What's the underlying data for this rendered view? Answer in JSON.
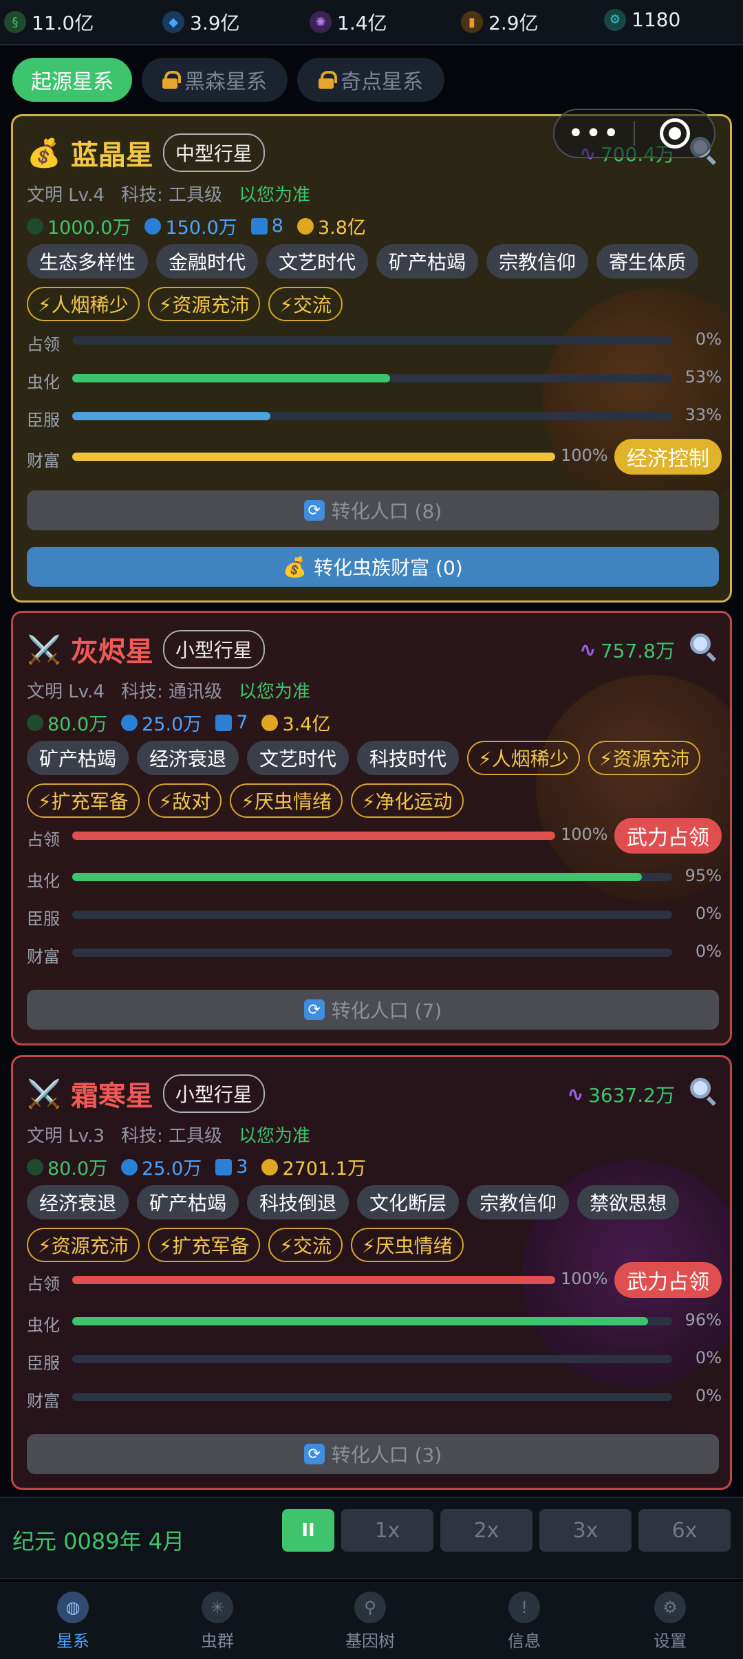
{
  "resources": [
    {
      "value": "11.0亿",
      "icon": "dna-icon",
      "color": "#3ec46d"
    },
    {
      "value": "3.9亿",
      "icon": "gem-icon",
      "color": "#4aa3ff"
    },
    {
      "value": "1.4亿",
      "icon": "energy-orb-icon",
      "color": "#9b5de5"
    },
    {
      "value": "2.9亿",
      "icon": "capsule-icon",
      "color": "#e69a2b"
    },
    {
      "value": "1180",
      "icon": "gear-icon",
      "color": "#2ec4c4"
    }
  ],
  "systems": [
    {
      "label": "起源星系",
      "locked": false
    },
    {
      "label": "黑森星系",
      "locked": true
    },
    {
      "label": "奇点星系",
      "locked": true
    }
  ],
  "capsule": {
    "more": "•••"
  },
  "planets": [
    {
      "emoji": "💰",
      "name": "蓝晶星",
      "size": "中型行星",
      "worm_value": "700.4万",
      "civ": "文明 Lv.4",
      "tech": "科技: 工具级",
      "note": "以您为准",
      "stats": {
        "dna": "1000.0万",
        "gem": "150.0万",
        "people": "8",
        "coin": "3.8亿"
      },
      "tags": [
        "生态多样性",
        "金融时代",
        "文艺时代",
        "矿产枯竭",
        "宗教信仰",
        "寄生体质"
      ],
      "events": [
        "⚡人烟稀少",
        "⚡资源充沛",
        "⚡交流"
      ],
      "bars": [
        {
          "label": "占领",
          "pct": "0%",
          "value": 0
        },
        {
          "label": "虫化",
          "pct": "53%",
          "value": 53
        },
        {
          "label": "臣服",
          "pct": "33%",
          "value": 33
        },
        {
          "label": "财富",
          "pct": "100%",
          "value": 100,
          "action": "经济控制"
        }
      ],
      "convert_pop": "转化人口 (8)",
      "convert_wealth": "转化虫族财富 (0)"
    },
    {
      "emoji": "⚔️",
      "name": "灰烬星",
      "size": "小型行星",
      "worm_value": "757.8万",
      "civ": "文明 Lv.4",
      "tech": "科技: 通讯级",
      "note": "以您为准",
      "stats": {
        "dna": "80.0万",
        "gem": "25.0万",
        "people": "7",
        "coin": "3.4亿"
      },
      "tags": [
        "矿产枯竭",
        "经济衰退",
        "文艺时代",
        "科技时代"
      ],
      "events": [
        "⚡人烟稀少",
        "⚡资源充沛",
        "⚡扩充军备",
        "⚡敌对",
        "⚡厌虫情绪",
        "⚡净化运动"
      ],
      "bars": [
        {
          "label": "占领",
          "pct": "100%",
          "value": 100,
          "action": "武力占领"
        },
        {
          "label": "虫化",
          "pct": "95%",
          "value": 95
        },
        {
          "label": "臣服",
          "pct": "0%",
          "value": 0
        },
        {
          "label": "财富",
          "pct": "0%",
          "value": 0
        }
      ],
      "convert_pop": "转化人口 (7)"
    },
    {
      "emoji": "⚔️",
      "name": "霜寒星",
      "size": "小型行星",
      "worm_value": "3637.2万",
      "civ": "文明 Lv.3",
      "tech": "科技: 工具级",
      "note": "以您为准",
      "stats": {
        "dna": "80.0万",
        "gem": "25.0万",
        "people": "3",
        "coin": "2701.1万"
      },
      "tags": [
        "经济衰退",
        "矿产枯竭",
        "科技倒退",
        "文化断层",
        "宗教信仰",
        "禁欲思想"
      ],
      "events": [
        "⚡资源充沛",
        "⚡扩充军备",
        "⚡交流",
        "⚡厌虫情绪"
      ],
      "bars": [
        {
          "label": "占领",
          "pct": "100%",
          "value": 100,
          "action": "武力占领"
        },
        {
          "label": "虫化",
          "pct": "96%",
          "value": 96
        },
        {
          "label": "臣服",
          "pct": "0%",
          "value": 0
        },
        {
          "label": "财富",
          "pct": "0%",
          "value": 0
        }
      ],
      "convert_pop": "转化人口 (3)"
    }
  ],
  "time": {
    "era": "纪元 0089年 4月",
    "pause": "II",
    "speeds": [
      "1x",
      "2x",
      "3x",
      "6x"
    ]
  },
  "nav": [
    {
      "label": "星系",
      "icon": "planet-icon",
      "active": true
    },
    {
      "label": "虫群",
      "icon": "swarm-icon",
      "active": false
    },
    {
      "label": "基因树",
      "icon": "gene-tree-icon",
      "active": false
    },
    {
      "label": "信息",
      "icon": "info-icon",
      "active": false
    },
    {
      "label": "设置",
      "icon": "settings-icon",
      "active": false
    }
  ]
}
